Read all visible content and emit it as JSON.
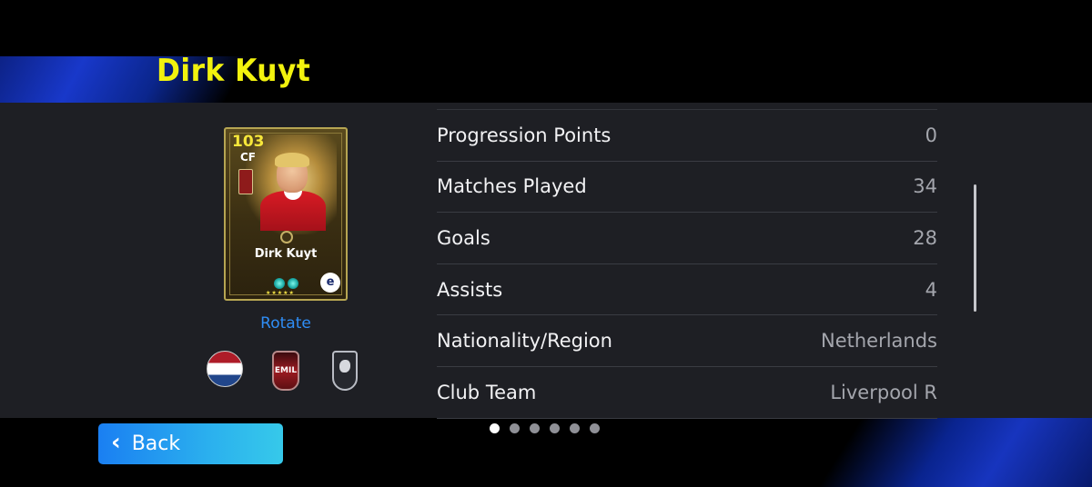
{
  "header": {
    "player_name": "Dirk Kuyt"
  },
  "card": {
    "rating": "103",
    "position": "CF",
    "name": "Dirk Kuyt",
    "stars": "★★★★★",
    "logo_glyph": "e"
  },
  "rotate_label": "Rotate",
  "badges": {
    "nationality_flag": "netherlands-flag-icon",
    "league": "EMIL",
    "league2_icon": "english-league-crest-icon"
  },
  "stats": [
    {
      "label": "Progression Points",
      "value": "0"
    },
    {
      "label": "Matches Played",
      "value": "34"
    },
    {
      "label": "Goals",
      "value": "28"
    },
    {
      "label": "Assists",
      "value": "4"
    },
    {
      "label": "Nationality/Region",
      "value": "Netherlands"
    },
    {
      "label": "Club Team",
      "value": "Liverpool R"
    }
  ],
  "pagination": {
    "total": 6,
    "active_index": 0
  },
  "back_button": {
    "label": "Back",
    "icon": "chevron-left-icon"
  },
  "colors": {
    "title": "#f2f20e",
    "accent_blue": "#1a7ff2",
    "rotate_link": "#2f8df5",
    "panel": "#1e1f24"
  }
}
